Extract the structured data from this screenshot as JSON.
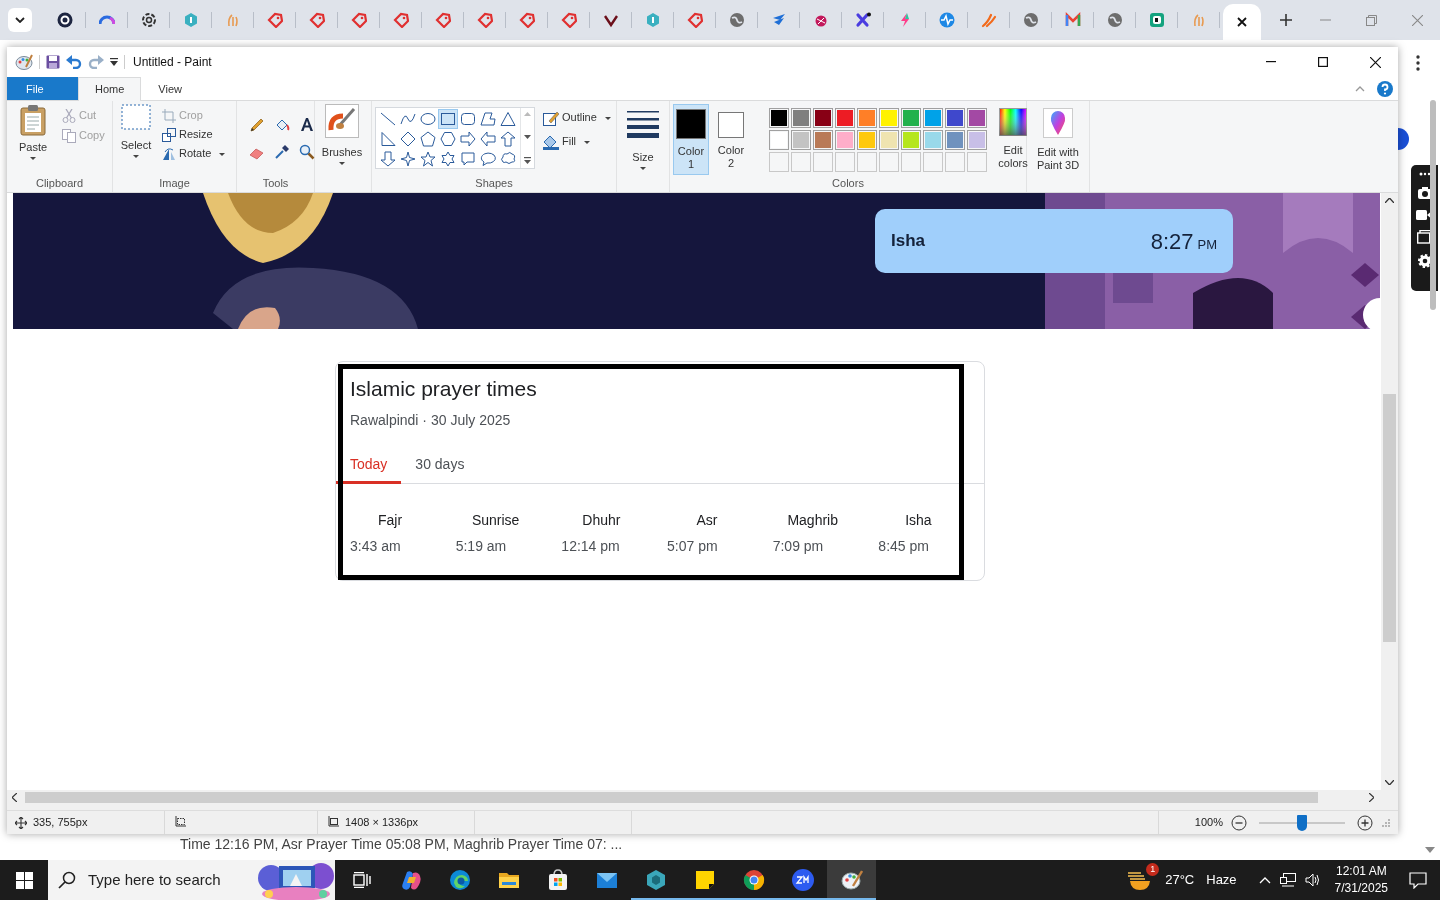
{
  "browser_tabs": [
    {
      "selected": false
    },
    {
      "selected": false
    },
    {
      "selected": false
    },
    {
      "selected": false
    },
    {
      "selected": false
    },
    {
      "selected": false
    },
    {
      "selected": false
    },
    {
      "selected": false
    },
    {
      "selected": false
    },
    {
      "selected": false
    },
    {
      "selected": false
    },
    {
      "selected": false
    },
    {
      "selected": false
    },
    {
      "selected": false
    },
    {
      "selected": false
    },
    {
      "selected": false
    },
    {
      "selected": false
    },
    {
      "selected": false
    },
    {
      "selected": false
    },
    {
      "selected": false
    },
    {
      "selected": false
    },
    {
      "selected": false
    },
    {
      "selected": false
    },
    {
      "selected": false
    },
    {
      "selected": false
    },
    {
      "selected": false
    },
    {
      "selected": false
    },
    {
      "selected": false
    },
    {
      "selected": true
    }
  ],
  "paint": {
    "title": "Untitled - Paint",
    "ribbon_tabs": [
      {
        "label": "File",
        "kind": "file"
      },
      {
        "label": "Home",
        "kind": "tab",
        "selected": true
      },
      {
        "label": "View",
        "kind": "tab",
        "selected": false
      }
    ],
    "clipboard": {
      "paste": "Paste",
      "cut": "Cut",
      "copy": "Copy",
      "group": "Clipboard"
    },
    "image": {
      "select": "Select",
      "crop": "Crop",
      "resize": "Resize",
      "rotate": "Rotate",
      "group": "Image"
    },
    "tools": {
      "group": "Tools"
    },
    "brushes": {
      "label": "Brushes"
    },
    "shapes": {
      "outline": "Outline",
      "fill": "Fill",
      "group": "Shapes",
      "items": [
        {
          "selected": false
        },
        {
          "selected": false
        },
        {
          "selected": false
        },
        {
          "selected": true
        },
        {
          "selected": false
        },
        {
          "selected": false
        },
        {
          "selected": false
        },
        {
          "selected": false
        },
        {
          "selected": false
        },
        {
          "selected": false
        },
        {
          "selected": false
        },
        {
          "selected": false
        },
        {
          "selected": false
        },
        {
          "selected": false
        },
        {
          "selected": false
        },
        {
          "selected": false
        },
        {
          "selected": false
        },
        {
          "selected": false
        },
        {
          "selected": false
        },
        {
          "selected": false
        },
        {
          "selected": false
        }
      ]
    },
    "size": {
      "label": "Size"
    },
    "colors": {
      "group": "Colors",
      "edit": "Edit colors",
      "current": [
        {
          "label": "Color 1",
          "color": "#000000",
          "selected": true
        },
        {
          "label": "Color 2",
          "color": "#ffffff",
          "selected": false
        }
      ],
      "palette": [
        {
          "color": "#000000"
        },
        {
          "color": "#7f7f7f"
        },
        {
          "color": "#880015"
        },
        {
          "color": "#ed1c24"
        },
        {
          "color": "#ff7f27"
        },
        {
          "color": "#fff200"
        },
        {
          "color": "#22b14c"
        },
        {
          "color": "#00a2e8"
        },
        {
          "color": "#3f48cc"
        },
        {
          "color": "#a349a4"
        },
        {
          "color": "#ffffff"
        },
        {
          "color": "#c3c3c3"
        },
        {
          "color": "#b97a57"
        },
        {
          "color": "#ffaec9"
        },
        {
          "color": "#ffc90e"
        },
        {
          "color": "#efe4b0"
        },
        {
          "color": "#b5e61d"
        },
        {
          "color": "#99d9ea"
        },
        {
          "color": "#7092be"
        },
        {
          "color": "#c8bfe7"
        }
      ]
    },
    "paint3d": {
      "label": "Edit with Paint 3D"
    },
    "canvas": {
      "banner": {
        "name": "Isha",
        "time": "8:27",
        "suffix": "PM"
      },
      "card": {
        "title": "Islamic prayer times",
        "subtitle": "Rawalpindi · 30 July 2025",
        "tabs": [
          {
            "label": "Today",
            "selected": true
          },
          {
            "label": "30 days",
            "selected": false
          }
        ],
        "times": [
          {
            "name": "Fajr",
            "time": "3:43 am"
          },
          {
            "name": "Sunrise",
            "time": "5:19 am"
          },
          {
            "name": "Dhuhr",
            "time": "12:14 pm"
          },
          {
            "name": "Asr",
            "time": "5:07 pm"
          },
          {
            "name": "Maghrib",
            "time": "7:09 pm"
          },
          {
            "name": "Isha",
            "time": "8:45 pm"
          }
        ]
      }
    },
    "status_bar": {
      "position": "335, 755px",
      "dimensions": "1408 × 1336px",
      "zoom": "100%",
      "zoom_slider": {
        "level": 0.5
      }
    }
  },
  "page_text": "Time 12:16 PM, Asr Prayer Time 05:08 PM, Maghrib Prayer Time 07: ...",
  "taskbar": {
    "search": {
      "placeholder": "Type here to search"
    },
    "apps": [
      {
        "running": false,
        "selected": false
      },
      {
        "running": false,
        "selected": false
      },
      {
        "running": false,
        "selected": false
      },
      {
        "running": false,
        "selected": false
      },
      {
        "running": false,
        "selected": false
      },
      {
        "running": true,
        "selected": false
      },
      {
        "running": true,
        "selected": false
      },
      {
        "running": true,
        "selected": false
      },
      {
        "running": true,
        "selected": false
      },
      {
        "running": true,
        "selected": true
      }
    ],
    "weather": {
      "badge": "1",
      "temperature": "27°C",
      "condition": "Haze"
    },
    "clock": {
      "time": "12:01 AM",
      "date": "7/31/2025"
    }
  }
}
